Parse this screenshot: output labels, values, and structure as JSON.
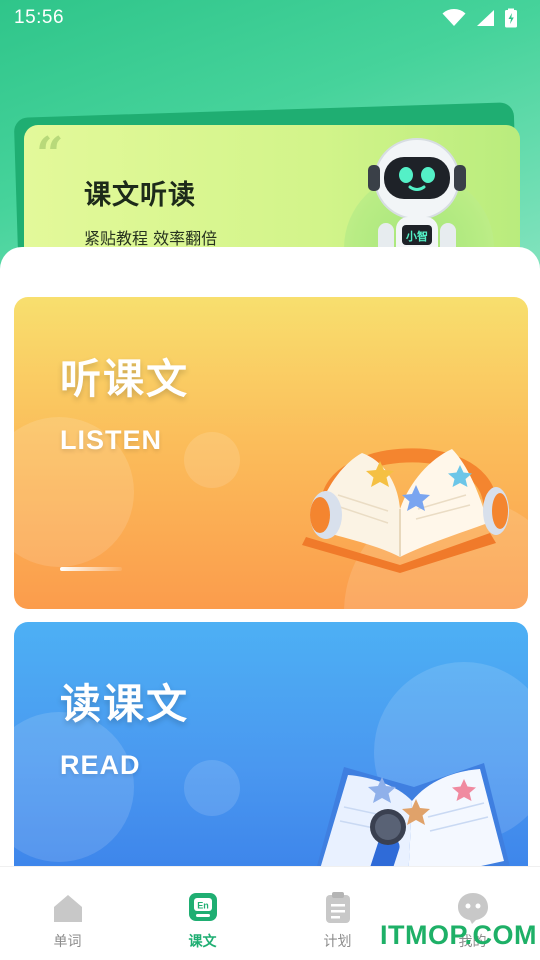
{
  "status_bar": {
    "time": "15:56"
  },
  "banner": {
    "quote_mark": "“",
    "title": "课文听读",
    "subtitle": "紧贴教程 效率翻倍",
    "mascot_badge": "小智"
  },
  "cards": [
    {
      "title": "听课文",
      "subtitle": "LISTEN"
    },
    {
      "title": "读课文",
      "subtitle": "READ"
    }
  ],
  "nav": {
    "items": [
      {
        "label": "单词",
        "icon": "house-icon",
        "active": false
      },
      {
        "label": "课文",
        "icon": "en-chat-icon",
        "icon_text": "En",
        "active": true
      },
      {
        "label": "计划",
        "icon": "clipboard-icon",
        "active": false
      },
      {
        "label": "我的",
        "icon": "profile-icon",
        "active": false
      }
    ]
  },
  "watermark": "ITMOP.COM",
  "colors": {
    "accent": "#1fae72",
    "listen_card": "#fbbe5b",
    "read_card": "#4a98f0"
  }
}
